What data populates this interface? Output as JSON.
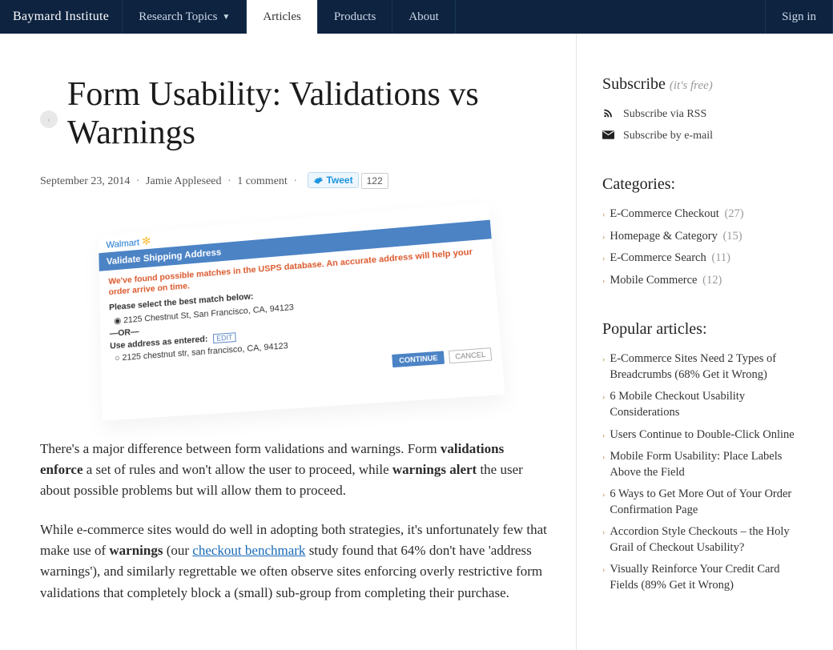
{
  "header": {
    "logo": "Baymard Institute",
    "nav": {
      "research": "Research Topics",
      "articles": "Articles",
      "products": "Products",
      "about": "About",
      "signin": "Sign in"
    }
  },
  "article": {
    "title": "Form Usability: Validations vs Warnings",
    "date": "September 23, 2014",
    "author": "Jamie Appleseed",
    "comments": "1 comment",
    "tweet_label": "Tweet",
    "tweet_count": "122",
    "figure": {
      "brand": "Walmart",
      "blue_bar": "Validate Shipping Address",
      "red_text": "We've found possible matches in the USPS database. An accurate address will help your order arrive on time.",
      "prompt": "Please select the best match below:",
      "addr1": "2125 Chestnut St, San Francisco, CA, 94123",
      "or": "—OR—",
      "use_label": "Use address as entered:",
      "addr2": "2125 chestnut str, san francisco, CA, 94123",
      "edit": "EDIT",
      "continue": "CONTINUE",
      "cancel": "CANCEL"
    },
    "para1_a": "There's a major difference between form validations and warnings. Form ",
    "para1_b": "validations enforce",
    "para1_c": " a set of rules and won't allow the user to proceed, while ",
    "para1_d": "warnings alert",
    "para1_e": " the user about possible problems but will allow them to proceed.",
    "para2_a": "While e-commerce sites would do well in adopting both strategies, it's unfortunately few that make use of ",
    "para2_b": "warnings",
    "para2_c": " (our ",
    "para2_link": "checkout benchmark",
    "para2_d": " study found that 64% don't have 'address warnings'), and similarly regrettable we often observe sites enforcing overly restrictive form validations that completely block a (small) sub-group from completing their purchase."
  },
  "sidebar": {
    "subscribe": {
      "title": "Subscribe",
      "free": "(it's free)",
      "rss": "Subscribe via RSS",
      "email": "Subscribe by e-mail"
    },
    "categories": {
      "title": "Categories:",
      "items": [
        {
          "label": "E-Commerce Checkout",
          "count": "(27)"
        },
        {
          "label": "Homepage & Category",
          "count": "(15)"
        },
        {
          "label": "E-Commerce Search",
          "count": "(11)"
        },
        {
          "label": "Mobile Commerce",
          "count": "(12)"
        }
      ]
    },
    "popular": {
      "title": "Popular articles:",
      "items": [
        {
          "label": "E-Commerce Sites Need 2 Types of Breadcrumbs (68% Get it Wrong)"
        },
        {
          "label": "6 Mobile Checkout Usability Considerations"
        },
        {
          "label": "Users Continue to Double-Click Online"
        },
        {
          "label": "Mobile Form Usability: Place Labels Above the Field"
        },
        {
          "label": "6 Ways to Get More Out of Your Order Confirmation Page"
        },
        {
          "label": "Accordion Style Checkouts – the Holy Grail of Checkout Usability?"
        },
        {
          "label": "Visually Reinforce Your Credit Card Fields (89% Get it Wrong)"
        }
      ]
    }
  }
}
